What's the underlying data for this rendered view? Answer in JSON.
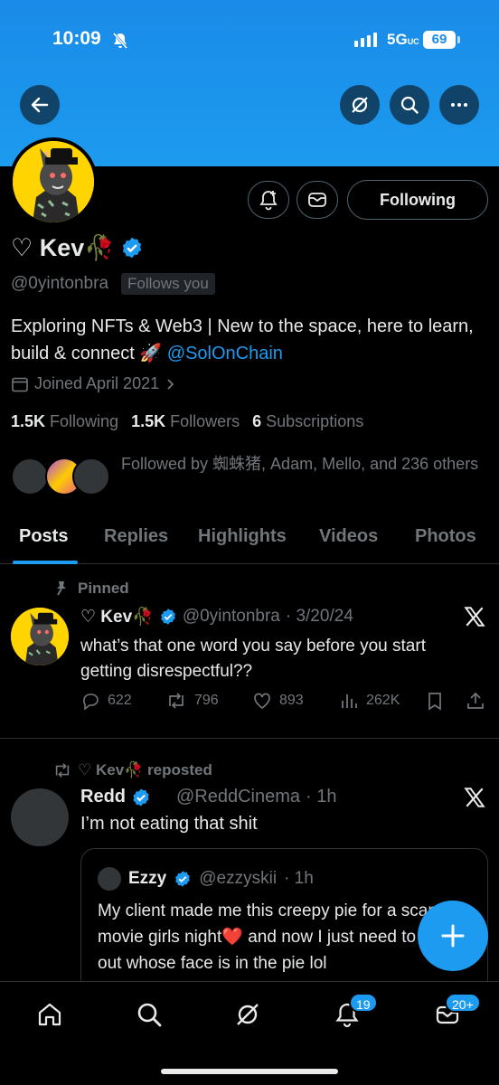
{
  "status_bar": {
    "time": "10:09",
    "network": "5G",
    "network_suffix": "UC",
    "battery": "69"
  },
  "colors": {
    "accent": "#1d9bf0",
    "banner": "#1c9bef",
    "avatar_bg": "#ffd400",
    "muted": "#71767b"
  },
  "header": {
    "back_icon": "arrow-left-icon",
    "grok_icon": "grok-icon",
    "search_icon": "search-icon",
    "more_icon": "more-dots-icon"
  },
  "profile": {
    "name": "♡ Kev🥀",
    "handle": "@0yintonbra",
    "follows_you": "Follows you",
    "following_button": "Following",
    "bio_text": "Exploring NFTs & Web3 | New to the space, here to learn, build & connect 🚀 ",
    "bio_link": "@SolOnChain",
    "joined": "Joined April 2021",
    "following_count": "1.5K",
    "following_label": "Following",
    "followers_count": "1.5K",
    "followers_label": "Followers",
    "subscriptions_count": "6",
    "subscriptions_label": "Subscriptions",
    "followed_by": "Followed by 蜘蛛猪, Adam, Mello, and 236 others"
  },
  "tabs": [
    "Posts",
    "Replies",
    "Highlights",
    "Videos",
    "Photos"
  ],
  "pinned_post": {
    "pinned_label": "Pinned",
    "name": "♡ Kev🥀",
    "handle": "@0yintonbra",
    "date": "· 3/20/24",
    "text": "what’s that one word you say before you start getting disrespectful??",
    "replies": "622",
    "reposts": "796",
    "likes": "893",
    "views": "262K"
  },
  "repost": {
    "repost_label": "♡ Kev🥀 reposted",
    "name": "Redd",
    "handle": "@ReddCinema",
    "time": "· 1h",
    "text": "I’m not eating that shit",
    "quote": {
      "name": "Ezzy",
      "handle": "@ezzyskii",
      "time": "· 1h",
      "text": "My client made me this creepy pie for a scary movie girls night❤️ and now I just need to figure out whose face is in the pie lol"
    }
  },
  "bottom_nav": {
    "notifications_badge": "19",
    "messages_badge": "20+"
  }
}
